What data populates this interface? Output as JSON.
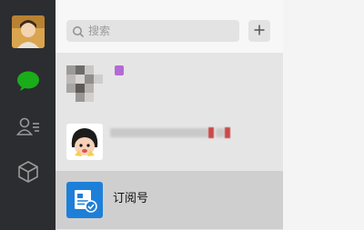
{
  "colors": {
    "rail_bg": "#2b2d30",
    "list_bg": "#e6e5e5",
    "search_bg": "#e3e3e3",
    "selected_row_bg": "#d0cfcf",
    "right_pane_bg": "#f4f4f4",
    "accent_green": "#1aad19",
    "subscription_blue": "#1d7fd8"
  },
  "rail": {
    "items": [
      {
        "icon": "chat-icon",
        "active": true
      },
      {
        "icon": "contacts-icon",
        "active": false
      },
      {
        "icon": "cube-icon",
        "active": false
      }
    ]
  },
  "search": {
    "placeholder": "搜索",
    "add_icon": "plus-icon"
  },
  "conversations": [
    {
      "type": "pixelated-avatar",
      "title_obscured": true
    },
    {
      "type": "cartoon-avatar",
      "title_obscured": true
    },
    {
      "type": "subscription",
      "title": "订阅号",
      "selected": true
    }
  ]
}
